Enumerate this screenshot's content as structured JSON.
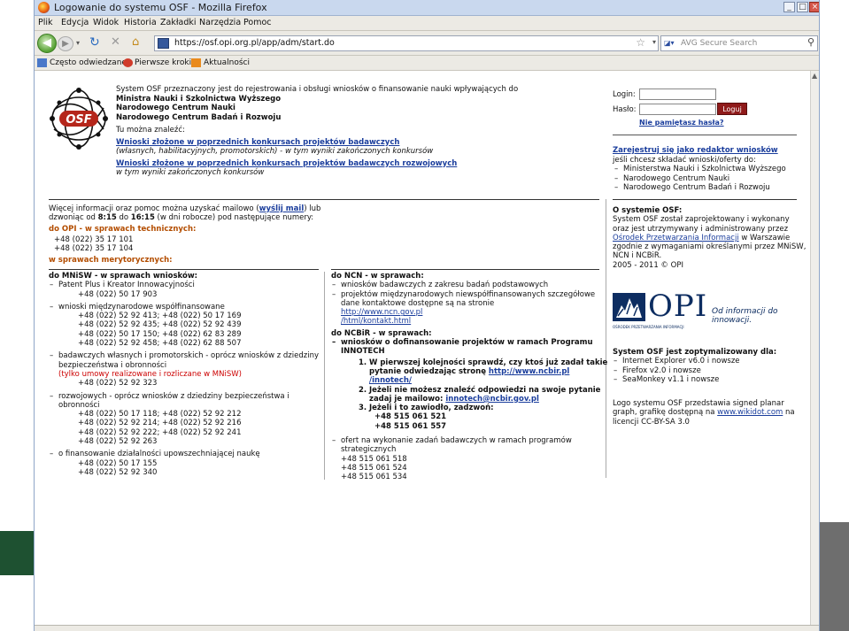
{
  "window": {
    "title": "Logowanie do systemu OSF - Mozilla Firefox"
  },
  "menu": [
    "Plik",
    "Edycja",
    "Widok",
    "Historia",
    "Zakładki",
    "Narzędzia",
    "Pomoc"
  ],
  "address": {
    "url": "https://osf.opi.org.pl/app/adm/start.do",
    "search_placeholder": "AVG Secure Search"
  },
  "bookmarks": [
    "Często odwiedzane",
    "Pierwsze kroki",
    "Aktualności"
  ],
  "intro": {
    "line1": "System OSF przeznaczony jest do rejestrowania i obsługi wniosków o finansowanie nauki wpływających do",
    "ministries": [
      "Ministra Nauki i Szkolnictwa Wyższego",
      "Narodowego Centrum Nauki",
      "Narodowego Centrum Badań i Rozwoju"
    ],
    "find_here": "Tu można znaleźć:",
    "link1": "Wnioski złożone w poprzednich konkursach projektów badawczych",
    "link1_note": "(własnych, habilitacyjnych, promotorskich) - w tym wyniki zakończonych konkursów",
    "link2": "Wnioski złożone w poprzednich konkursach projektów badawczych rozwojowych",
    "link2_note": "w tym wyniki zakończonych konkursów"
  },
  "login": {
    "login_label": "Login:",
    "password_label": "Hasło:",
    "button": "Loguj",
    "forgot": "Nie pamiętasz hasła?"
  },
  "register": {
    "link": "Zarejestruj się jako redaktor wniosków",
    "note": "jeśli chcesz składać wnioski/oferty do:",
    "items": [
      "Ministerstwa Nauki i Szkolnictwa Wyższego",
      "Narodowego Centrum Nauki",
      "Narodowego Centrum Badań i Rozwoju"
    ]
  },
  "contact": {
    "line1a": "Więcej informacji oraz pomoc można uzyskać mailowo (",
    "mail_link": "wyślij mail",
    "line1b": ") lub",
    "line2a": "dzwoniąc od ",
    "time_from": "8:15",
    "line2b": " do ",
    "time_to": "16:15",
    "line2c": " (w dni robocze) pod następujące numery:",
    "tech_head": "do OPI - w sprawach technicznych:",
    "tech_phones": [
      "+48 (022) 35 17 101",
      "+48 (022) 35 17 104"
    ],
    "merit_head": "w sprawach merytorycznych:"
  },
  "mnisw": {
    "head": "do MNiSW - w sprawach wniosków:",
    "items": [
      {
        "title": "Patent Plus i Kreator Innowacyjności",
        "lines": [
          "+48 (022) 50 17 903"
        ]
      },
      {
        "title": "wnioski międzynarodowe współfinansowane",
        "lines": [
          "+48 (022) 52 92 413; +48 (022) 50 17 169",
          "+48 (022) 52 92 435; +48 (022) 52 92 439",
          "+48 (022) 50 17 150; +48 (022) 62 83 289",
          "+48 (022) 52 92 458; +48 (022) 62 88 507"
        ]
      },
      {
        "title": "badawczych własnych i promotorskich - oprócz wniosków z dziedziny bezpieczeństwa i obronności",
        "red": "(tylko umowy realizowane i rozliczane w MNiSW)",
        "lines": [
          "+48 (022) 52 92 323"
        ]
      },
      {
        "title": "rozwojowych - oprócz wniosków z dziedziny bezpieczeństwa i obronności",
        "lines": [
          "+48 (022) 50 17 118; +48 (022) 52 92 212",
          "+48 (022) 52 92 214; +48 (022) 52 92 216",
          "+48 (022) 52 92 222; +48 (022) 52 92 241",
          "+48 (022) 52 92 263"
        ]
      },
      {
        "title": "o finansowanie działalności upowszechniającej naukę",
        "lines": [
          "+48 (022) 50 17 155",
          "+48 (022) 52 92 340"
        ]
      }
    ]
  },
  "ncn": {
    "head": "do NCN - w sprawach:",
    "item1": "wniosków badawczych z zakresu badań podstawowych",
    "item2": "projektów międzynarodowych niewspółfinansowanych szczegółowe dane kontaktowe dostępne są na stronie",
    "link": "http://www.ncn.gov.pl",
    "link2": "/html/kontakt.html"
  },
  "ncbir": {
    "head": "do NCBiR - w sprawach:",
    "item1": "wniosków o dofinansowanie projektów w ramach Programu INNOTECH",
    "steps": [
      {
        "n": "1.",
        "text": "W pierwszej kolejności sprawdź, czy ktoś już zadał takie pytanie odwiedzając stronę ",
        "link": "http://www.ncbir.pl",
        "link2": "/innotech/"
      },
      {
        "n": "2.",
        "text": "Jeżeli nie możesz znaleźć odpowiedzi na swoje pytanie zadaj je mailowo: ",
        "link": "innotech@ncbir.gov.pl"
      },
      {
        "n": "3.",
        "text": "Jeżeli i to zawiodło, zadzwoń:",
        "phones": [
          "+48 515 061 521",
          "+48 515 061 557"
        ]
      }
    ],
    "item2": "ofert na wykonanie zadań badawczych w ramach programów strategicznych",
    "item2_phones": [
      "+48 515 061 518",
      "+48 515 061 524",
      "+48 515 061 534"
    ]
  },
  "about": {
    "head": "O systemie OSF:",
    "text1": "System OSF został zaprojektowany i wykonany oraz jest utrzymywany i administrowany przez",
    "link": "Ośrodek Przetwarzania Informacji",
    "text2": " w Warszawie zgodnie z wymaganiami określanymi przez MNiSW, NCN i NCBiR.",
    "copyright": "2005 - 2011 © OPI"
  },
  "opi_logo": {
    "letters": "OPI",
    "tagline": "Od informacji do innowacji.",
    "sub": "OŚRODEK PRZETWARZANIA INFORMACJI"
  },
  "optimized": {
    "head": "System OSF jest zoptymalizowany dla:",
    "items": [
      "Internet Explorer v6.0 i nowsze",
      "Firefox v2.0 i nowsze",
      "SeaMonkey v1.1 i nowsze"
    ]
  },
  "logo_note": {
    "text1": "Logo systemu OSF przedstawia signed planar graph, grafikę dostępną na ",
    "link": "www.wikidot.com",
    "text2": " na licencji CC-BY-SA 3.0"
  },
  "osf_logo": {
    "text": "OSF"
  },
  "colors": {
    "accent": "#1a3d9c",
    "login_button": "#8f1a1a",
    "orange_head": "#b34d00"
  }
}
